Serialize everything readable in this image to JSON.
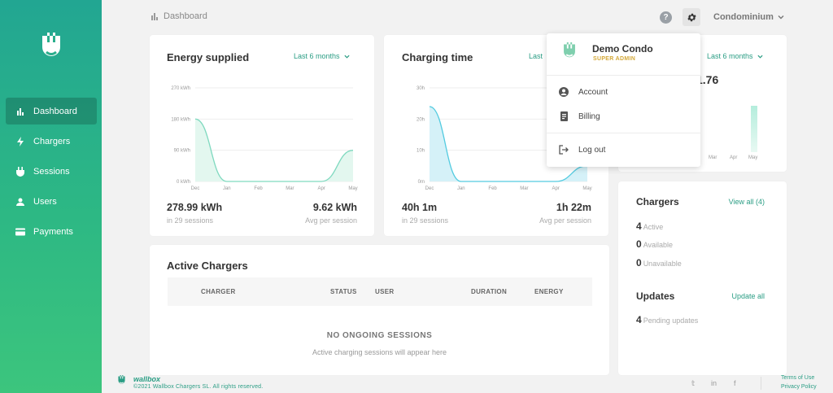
{
  "colors": {
    "brand": "#2a9d84",
    "sidebar_top": "#22a692",
    "sidebar_bottom": "#3cc57d",
    "role": "#d4a93a"
  },
  "sidebar": {
    "items": [
      {
        "label": "Dashboard",
        "icon": "bar-chart-icon",
        "active": true
      },
      {
        "label": "Chargers",
        "icon": "bolt-icon"
      },
      {
        "label": "Sessions",
        "icon": "plug-icon"
      },
      {
        "label": "Users",
        "icon": "user-icon"
      },
      {
        "label": "Payments",
        "icon": "credit-card-icon"
      }
    ]
  },
  "header": {
    "title": "Dashboard",
    "help": "?",
    "organization": "Condominium"
  },
  "energy": {
    "title": "Energy supplied",
    "period": "Last 6 months",
    "total": "278.99 kWh",
    "total_sub": "in 29 sessions",
    "avg": "9.62 kWh",
    "avg_sub": "Avg per session",
    "chart_data": {
      "type": "area",
      "categories": [
        "Dec",
        "Jan",
        "Feb",
        "Mar",
        "Apr",
        "May"
      ],
      "values": [
        180,
        0,
        0,
        0,
        0,
        90
      ],
      "y_ticks": [
        "270 kWh",
        "180 kWh",
        "90 kWh",
        "0 kWh"
      ],
      "ylim": [
        0,
        270
      ],
      "color": "#7fd9bf",
      "fill": "#e3f7ef"
    }
  },
  "charging": {
    "title": "Charging time",
    "period": "Last 6 months",
    "period_partial": "Last",
    "total": "40h 1m",
    "total_sub": "in 29 sessions",
    "avg": "1h 22m",
    "avg_sub": "Avg per session",
    "chart_data": {
      "type": "area",
      "categories": [
        "Dec",
        "Jan",
        "Feb",
        "Mar",
        "Apr",
        "May"
      ],
      "values": [
        24,
        0,
        0,
        0,
        0,
        5
      ],
      "y_ticks": [
        "30h",
        "20h",
        "10h",
        "0m"
      ],
      "ylim": [
        0,
        30
      ],
      "color": "#53cbe0",
      "fill": "#d5f1f8"
    }
  },
  "third": {
    "period": "Last 6 months",
    "value": "1.76",
    "x_labels": [
      "Mar",
      "Apr",
      "May"
    ]
  },
  "active_chargers": {
    "title": "Active Chargers",
    "columns": [
      "CHARGER",
      "STATUS",
      "USER",
      "DURATION",
      "ENERGY"
    ],
    "empty_title": "NO ONGOING SESSIONS",
    "empty_sub": "Active charging sessions will appear here"
  },
  "chargers": {
    "title": "Chargers",
    "view_all": "View all (4)",
    "stats": [
      {
        "count": "4",
        "label": "Active"
      },
      {
        "count": "0",
        "label": "Available"
      },
      {
        "count": "0",
        "label": "Unavailable"
      }
    ]
  },
  "updates": {
    "title": "Updates",
    "action": "Update all",
    "count": "4",
    "label": "Pending updates"
  },
  "dropdown": {
    "name": "Demo Condo",
    "role": "SUPER ADMIN",
    "items": [
      {
        "label": "Account",
        "icon": "account-circle-icon"
      },
      {
        "label": "Billing",
        "icon": "receipt-icon"
      },
      {
        "label": "Log out",
        "icon": "logout-icon"
      }
    ]
  },
  "footer": {
    "brand": "wallbox",
    "copyright": "©2021 Wallbox Chargers SL. All rights reserved.",
    "social": [
      "twitter-icon",
      "linkedin-icon",
      "facebook-icon"
    ],
    "social_glyphs": [
      "𝕥",
      "in",
      "f"
    ],
    "terms": "Terms of Use",
    "privacy": "Privacy Policy"
  }
}
